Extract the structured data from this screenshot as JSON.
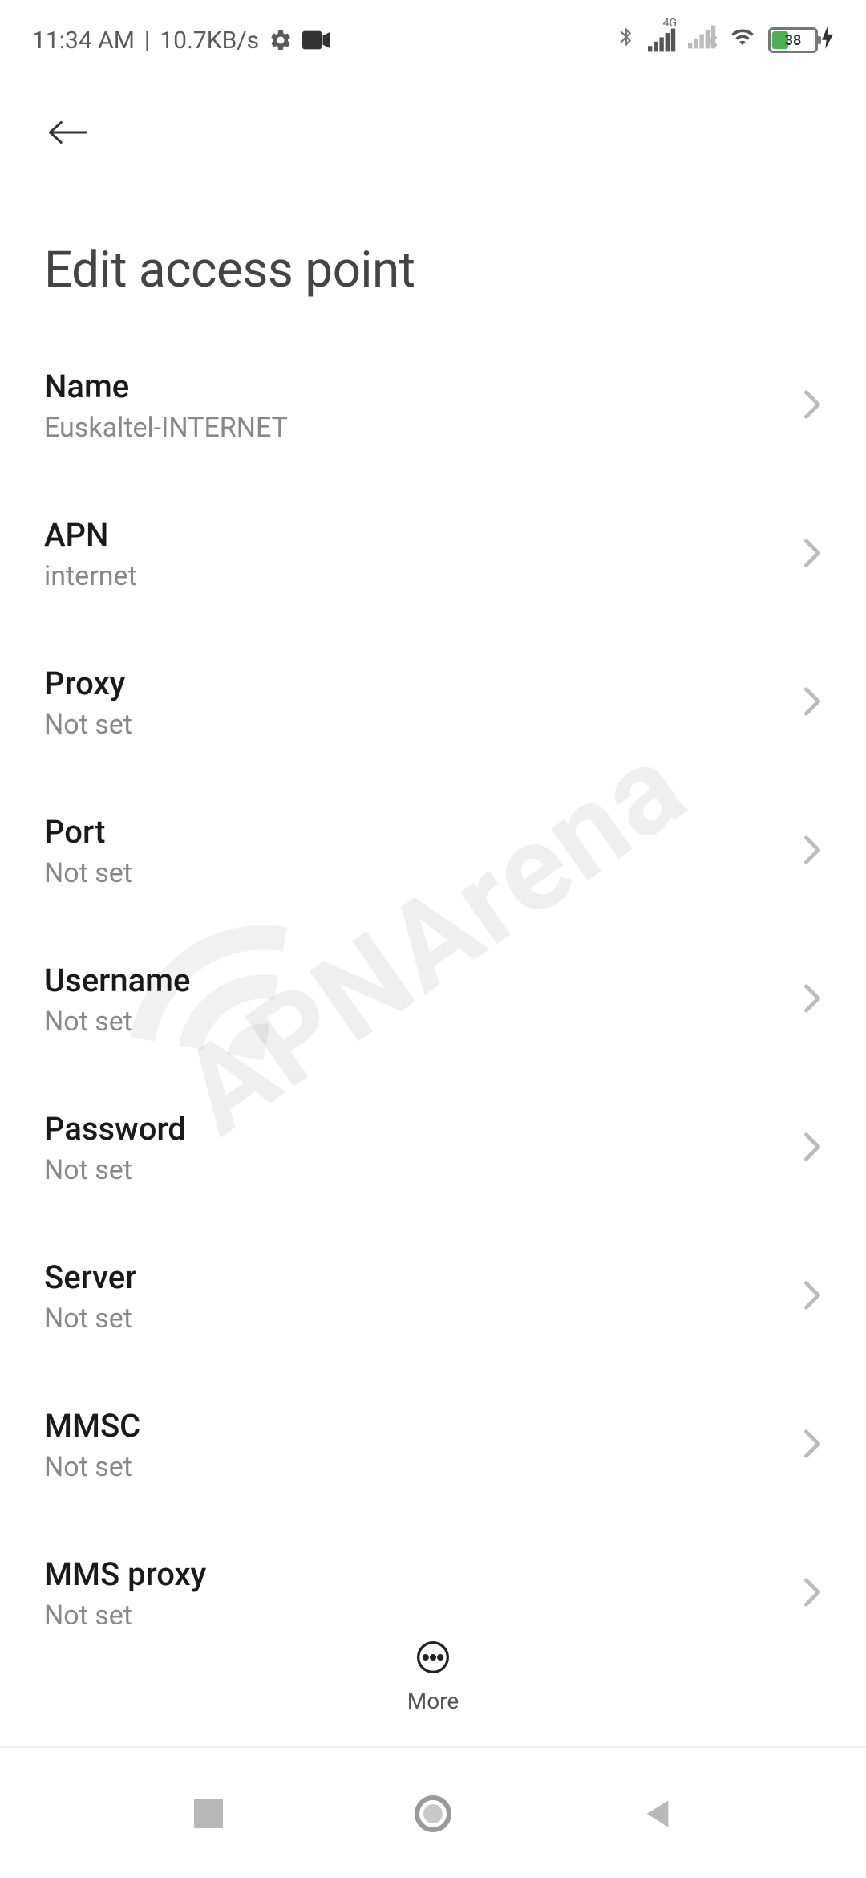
{
  "statusbar": {
    "time": "11:34 AM",
    "separator": "|",
    "speed": "10.7KB/s",
    "battery_percent": "38"
  },
  "header": {
    "title": "Edit access point"
  },
  "settings": [
    {
      "label": "Name",
      "value": "Euskaltel-INTERNET"
    },
    {
      "label": "APN",
      "value": "internet"
    },
    {
      "label": "Proxy",
      "value": "Not set"
    },
    {
      "label": "Port",
      "value": "Not set"
    },
    {
      "label": "Username",
      "value": "Not set"
    },
    {
      "label": "Password",
      "value": "Not set"
    },
    {
      "label": "Server",
      "value": "Not set"
    },
    {
      "label": "MMSC",
      "value": "Not set"
    },
    {
      "label": "MMS proxy",
      "value": "Not set"
    }
  ],
  "bottombar": {
    "more_label": "More"
  },
  "watermark": "APNArena"
}
